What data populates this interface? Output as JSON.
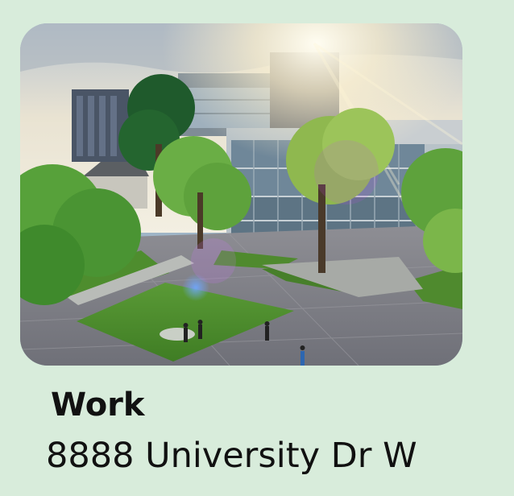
{
  "place": {
    "label": "Work",
    "address": "8888 University Dr W",
    "photo_icon": "campus-photo"
  },
  "colors": {
    "background": "#d8ecdb",
    "text": "#111111"
  }
}
